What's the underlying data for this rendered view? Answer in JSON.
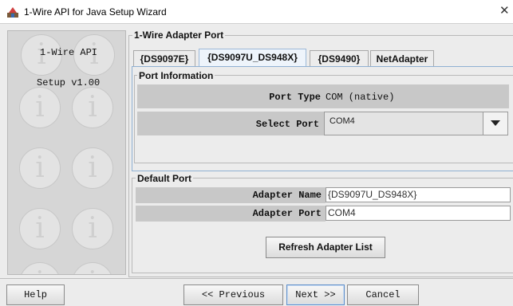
{
  "window": {
    "title": "1-Wire API for Java Setup Wizard",
    "close_glyph": "✕"
  },
  "sidebar": {
    "line1": "1-Wire API",
    "line2": "Setup v1.00"
  },
  "adapter_port": {
    "group_title": "1-Wire Adapter Port",
    "tabs": [
      {
        "label": "{DS9097E}"
      },
      {
        "label": "{DS9097U_DS948X}",
        "selected": true
      },
      {
        "label": "{DS9490}"
      },
      {
        "label": "NetAdapter"
      }
    ],
    "port_info": {
      "title": "Port Information",
      "port_type_label": "Port Type",
      "port_type_value": "COM (native)",
      "select_port_label": "Select Port",
      "select_port_value": "COM4"
    }
  },
  "default_port": {
    "title": "Default Port",
    "adapter_name_label": "Adapter Name",
    "adapter_name_value": "{DS9097U_DS948X}",
    "adapter_port_label": "Adapter Port",
    "adapter_port_value": "COM4",
    "refresh_label": "Refresh Adapter List"
  },
  "footer": {
    "help_label": "Help",
    "previous_label": "<< Previous",
    "next_label": "Next >>",
    "cancel_label": "Cancel"
  },
  "icons": [
    "app-icon",
    "info-icon",
    "chevron-down-icon",
    "close-icon"
  ]
}
